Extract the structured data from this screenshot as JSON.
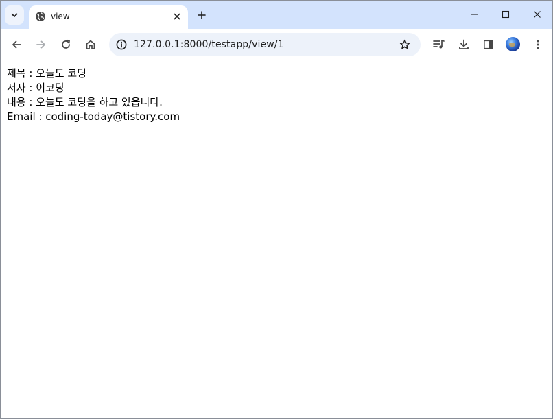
{
  "browser": {
    "tab": {
      "title": "view"
    },
    "address_bar": {
      "url": "127.0.0.1:8000/testapp/view/1"
    }
  },
  "page": {
    "lines": [
      {
        "label": "제목",
        "separator": " : ",
        "value": "오늘도 코딩"
      },
      {
        "label": "저자",
        "separator": " : ",
        "value": "이코딩"
      },
      {
        "label": "내용",
        "separator": " : ",
        "value": "오늘도 코딩을 하고 있읍니다."
      },
      {
        "label": "Email",
        "separator": " : ",
        "value": "coding-today@tistory.com"
      }
    ]
  },
  "colors": {
    "tabstrip_bg": "#d3e3fd",
    "omnibox_bg": "#edf2fa",
    "icon": "#474747"
  }
}
